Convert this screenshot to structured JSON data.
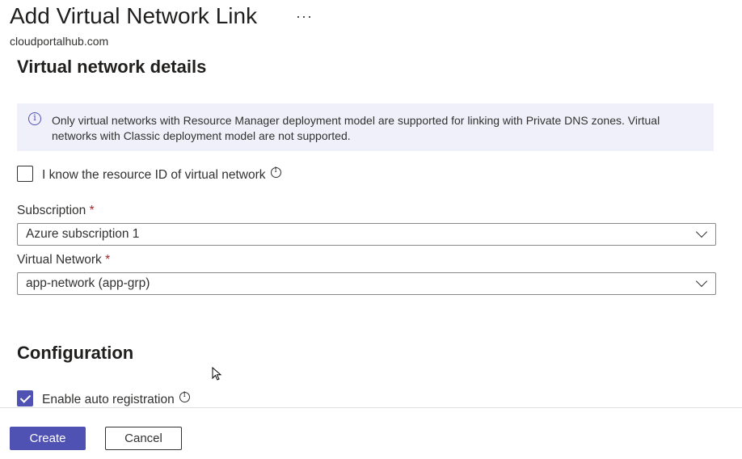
{
  "header": {
    "title": "Add Virtual Network Link",
    "more_label": "···",
    "subtitle": "cloudportalhub.com"
  },
  "vnet_section": {
    "heading": "Virtual network details",
    "info_icon": "info-icon",
    "info_text": "Only virtual networks with Resource Manager deployment model are supported for linking with Private DNS zones. Virtual networks with Classic deployment model are not supported.",
    "resource_id_checkbox": {
      "label": "I know the resource ID of virtual network",
      "checked": false
    },
    "subscription": {
      "label": "Subscription",
      "required_mark": "*",
      "value": "Azure subscription 1"
    },
    "virtual_network": {
      "label": "Virtual Network",
      "required_mark": "*",
      "value": "app-network (app-grp)"
    }
  },
  "config_section": {
    "heading": "Configuration",
    "auto_registration": {
      "label": "Enable auto registration",
      "checked": true
    }
  },
  "footer": {
    "create_label": "Create",
    "cancel_label": "Cancel"
  },
  "colors": {
    "accent": "#4f52b2",
    "info_background": "#f0f0fa",
    "required": "#a4262c"
  }
}
